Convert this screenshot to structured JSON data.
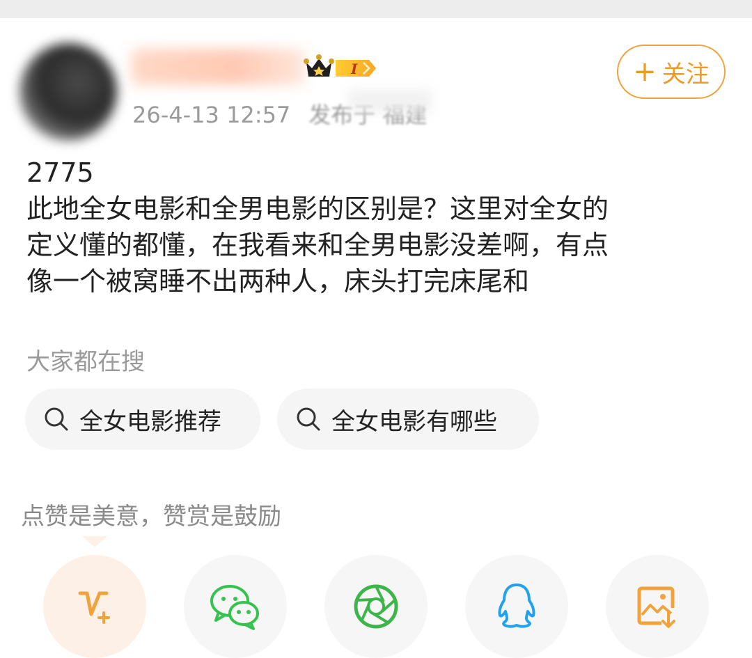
{
  "header": {
    "time": "26-4-13 12:57",
    "location": "发布于 福建",
    "level_badge": "I",
    "follow_label": "关注"
  },
  "post": {
    "number": "2775",
    "lines": [
      "此地全女电影和全男电影的区别是？这里对全女的",
      "定义懂的都懂，在我看来和全男电影没差啊，有点",
      "像一个被窝睡不出两种人，床头打完床尾和"
    ]
  },
  "search": {
    "title": "大家都在搜",
    "chips": [
      "全女电影推荐",
      "全女电影有哪些"
    ]
  },
  "praise_text": "点赞是美意，赞赏是鼓励",
  "share": {
    "items": [
      {
        "icon": "v-plus-icon",
        "color": "#f0a33c"
      },
      {
        "icon": "wechat-icon",
        "color": "#35c24f"
      },
      {
        "icon": "moments-icon",
        "color": "#3eb54a"
      },
      {
        "icon": "qq-icon",
        "color": "#22a2ee"
      },
      {
        "icon": "save-image-icon",
        "color": "#f0a33c"
      }
    ]
  },
  "colors": {
    "accent": "#f0a33c",
    "muted": "#9a9a9a"
  }
}
